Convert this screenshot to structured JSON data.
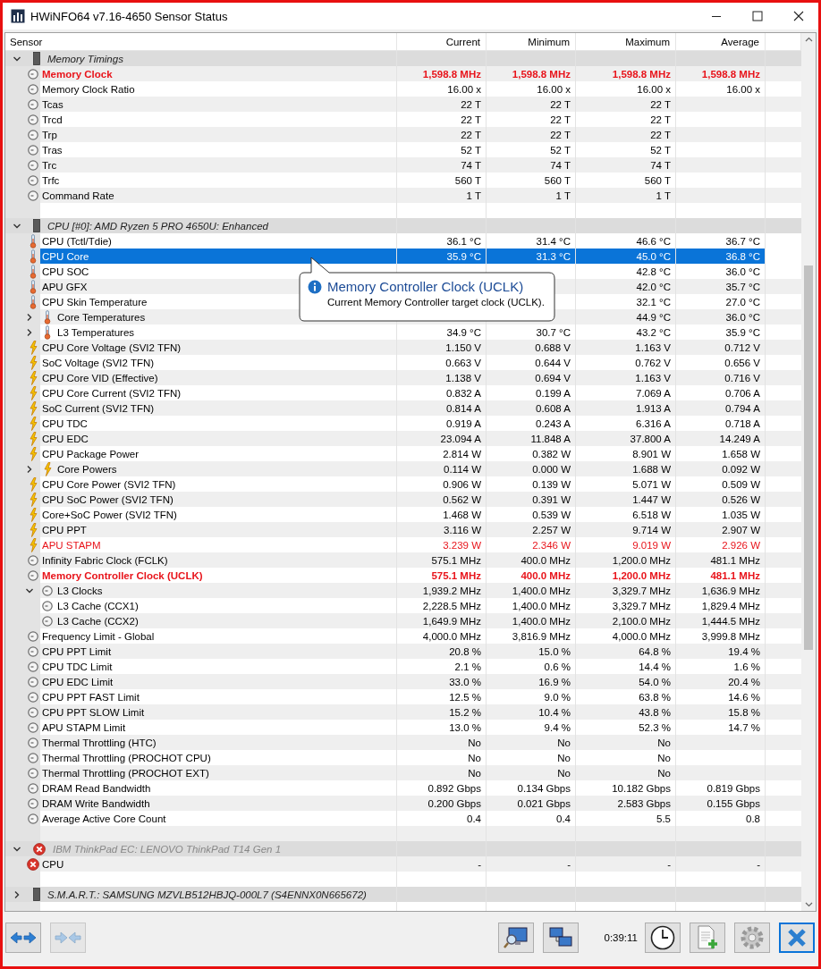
{
  "window": {
    "title": "HWiNFO64 v7.16-4650 Sensor Status"
  },
  "columns": [
    "Sensor",
    "Current",
    "Minimum",
    "Maximum",
    "Average"
  ],
  "groups": [
    {
      "name": "Memory Timings",
      "kind": "device",
      "expanded": true,
      "disabled": false,
      "selected": false,
      "items": [
        {
          "kind": "clock",
          "name": "Memory Clock",
          "color": "#e8141b",
          "emphasized": true,
          "selected": false,
          "current": "1,598.8 MHz",
          "minimum": "1,598.8 MHz",
          "maximum": "1,598.8 MHz",
          "average": "1,598.8 MHz"
        },
        {
          "kind": "clock",
          "name": "Memory Clock Ratio",
          "selected": false,
          "current": "16.00 x",
          "minimum": "16.00 x",
          "maximum": "16.00 x",
          "average": "16.00 x"
        },
        {
          "kind": "clock",
          "name": "Tcas",
          "selected": false,
          "current": "22 T",
          "minimum": "22 T",
          "maximum": "22 T"
        },
        {
          "kind": "clock",
          "name": "Trcd",
          "selected": false,
          "current": "22 T",
          "minimum": "22 T",
          "maximum": "22 T"
        },
        {
          "kind": "clock",
          "name": "Trp",
          "selected": false,
          "current": "22 T",
          "minimum": "22 T",
          "maximum": "22 T"
        },
        {
          "kind": "clock",
          "name": "Tras",
          "selected": false,
          "current": "52 T",
          "minimum": "52 T",
          "maximum": "52 T"
        },
        {
          "kind": "clock",
          "name": "Trc",
          "selected": false,
          "current": "74 T",
          "minimum": "74 T",
          "maximum": "74 T"
        },
        {
          "kind": "clock",
          "name": "Trfc",
          "selected": false,
          "current": "560 T",
          "minimum": "560 T",
          "maximum": "560 T"
        },
        {
          "kind": "clock",
          "name": "Command Rate",
          "selected": false,
          "current": "1 T",
          "minimum": "1 T",
          "maximum": "1 T"
        }
      ]
    },
    {
      "name": "CPU [#0]: AMD Ryzen 5 PRO 4650U: Enhanced",
      "kind": "device",
      "expanded": true,
      "disabled": false,
      "selected": false,
      "items": [
        {
          "kind": "temp",
          "name": "CPU (Tctl/Tdie)",
          "selected": false,
          "current": "36.1 °C",
          "minimum": "31.4 °C",
          "maximum": "46.6 °C",
          "average": "36.7 °C"
        },
        {
          "kind": "temp",
          "name": "CPU Core",
          "selected": true,
          "current": "35.9 °C",
          "minimum": "31.3 °C",
          "maximum": "45.0 °C",
          "average": "36.8 °C"
        },
        {
          "kind": "temp",
          "name": "CPU SOC",
          "selected": false,
          "maximum": "42.8 °C",
          "average": "36.0 °C"
        },
        {
          "kind": "temp",
          "name": "APU GFX",
          "selected": false,
          "maximum": "42.0 °C",
          "average": "35.7 °C"
        },
        {
          "kind": "temp",
          "name": "CPU Skin Temperature",
          "selected": false,
          "maximum": "32.1 °C",
          "average": "27.0 °C"
        },
        {
          "kind": "temp",
          "name": "Core Temperatures",
          "expanded": false,
          "selected": false,
          "maximum": "44.9 °C",
          "average": "36.0 °C"
        },
        {
          "kind": "temp",
          "name": "L3 Temperatures",
          "expanded": false,
          "selected": false,
          "current": "34.9 °C",
          "minimum": "30.7 °C",
          "maximum": "43.2 °C",
          "average": "35.9 °C"
        },
        {
          "kind": "power",
          "name": "CPU Core Voltage (SVI2 TFN)",
          "selected": false,
          "current": "1.150 V",
          "minimum": "0.688 V",
          "maximum": "1.163 V",
          "average": "0.712 V"
        },
        {
          "kind": "power",
          "name": "SoC Voltage (SVI2 TFN)",
          "selected": false,
          "current": "0.663 V",
          "minimum": "0.644 V",
          "maximum": "0.762 V",
          "average": "0.656 V"
        },
        {
          "kind": "power",
          "name": "CPU Core VID (Effective)",
          "selected": false,
          "current": "1.138 V",
          "minimum": "0.694 V",
          "maximum": "1.163 V",
          "average": "0.716 V"
        },
        {
          "kind": "power",
          "name": "CPU Core Current (SVI2 TFN)",
          "selected": false,
          "current": "0.832 A",
          "minimum": "0.199 A",
          "maximum": "7.069 A",
          "average": "0.706 A"
        },
        {
          "kind": "power",
          "name": "SoC Current (SVI2 TFN)",
          "selected": false,
          "current": "0.814 A",
          "minimum": "0.608 A",
          "maximum": "1.913 A",
          "average": "0.794 A"
        },
        {
          "kind": "power",
          "name": "CPU TDC",
          "selected": false,
          "current": "0.919 A",
          "minimum": "0.243 A",
          "maximum": "6.316 A",
          "average": "0.718 A"
        },
        {
          "kind": "power",
          "name": "CPU EDC",
          "selected": false,
          "current": "23.094 A",
          "minimum": "11.848 A",
          "maximum": "37.800 A",
          "average": "14.249 A"
        },
        {
          "kind": "power",
          "name": "CPU Package Power",
          "selected": false,
          "current": "2.814 W",
          "minimum": "0.382 W",
          "maximum": "8.901 W",
          "average": "1.658 W"
        },
        {
          "kind": "power",
          "name": "Core Powers",
          "expanded": false,
          "selected": false,
          "current": "0.114 W",
          "minimum": "0.000 W",
          "maximum": "1.688 W",
          "average": "0.092 W"
        },
        {
          "kind": "power",
          "name": "CPU Core Power (SVI2 TFN)",
          "selected": false,
          "current": "0.906 W",
          "minimum": "0.139 W",
          "maximum": "5.071 W",
          "average": "0.509 W"
        },
        {
          "kind": "power",
          "name": "CPU SoC Power (SVI2 TFN)",
          "selected": false,
          "current": "0.562 W",
          "minimum": "0.391 W",
          "maximum": "1.447 W",
          "average": "0.526 W"
        },
        {
          "kind": "power",
          "name": "Core+SoC Power (SVI2 TFN)",
          "selected": false,
          "current": "1.468 W",
          "minimum": "0.539 W",
          "maximum": "6.518 W",
          "average": "1.035 W"
        },
        {
          "kind": "power",
          "name": "CPU PPT",
          "selected": false,
          "current": "3.116 W",
          "minimum": "2.257 W",
          "maximum": "9.714 W",
          "average": "2.907 W"
        },
        {
          "kind": "power",
          "name": "APU STAPM",
          "color": "#e8141b",
          "emphasized": false,
          "selected": false,
          "current": "3.239 W",
          "minimum": "2.346 W",
          "maximum": "9.019 W",
          "average": "2.926 W"
        },
        {
          "kind": "clock",
          "name": "Infinity Fabric Clock (FCLK)",
          "selected": false,
          "current": "575.1 MHz",
          "minimum": "400.0 MHz",
          "maximum": "1,200.0 MHz",
          "average": "481.1 MHz"
        },
        {
          "kind": "clock",
          "name": "Memory Controller Clock (UCLK)",
          "color": "#e8141b",
          "emphasized": true,
          "selected": false,
          "current": "575.1 MHz",
          "minimum": "400.0 MHz",
          "maximum": "1,200.0 MHz",
          "average": "481.1 MHz"
        },
        {
          "kind": "clock",
          "name": "L3 Clocks",
          "expanded": true,
          "selected": false,
          "current": "1,939.2 MHz",
          "minimum": "1,400.0 MHz",
          "maximum": "3,329.7 MHz",
          "average": "1,636.9 MHz",
          "children": [
            {
              "kind": "clock",
              "name": "L3 Cache (CCX1)",
              "selected": false,
              "current": "2,228.5 MHz",
              "minimum": "1,400.0 MHz",
              "maximum": "3,329.7 MHz",
              "average": "1,829.4 MHz"
            },
            {
              "kind": "clock",
              "name": "L3 Cache (CCX2)",
              "selected": false,
              "current": "1,649.9 MHz",
              "minimum": "1,400.0 MHz",
              "maximum": "2,100.0 MHz",
              "average": "1,444.5 MHz"
            }
          ]
        },
        {
          "kind": "clock",
          "name": "Frequency Limit - Global",
          "selected": false,
          "current": "4,000.0 MHz",
          "minimum": "3,816.9 MHz",
          "maximum": "4,000.0 MHz",
          "average": "3,999.8 MHz"
        },
        {
          "kind": "clock",
          "name": "CPU PPT Limit",
          "selected": false,
          "current": "20.8 %",
          "minimum": "15.0 %",
          "maximum": "64.8 %",
          "average": "19.4 %"
        },
        {
          "kind": "clock",
          "name": "CPU TDC Limit",
          "selected": false,
          "current": "2.1 %",
          "minimum": "0.6 %",
          "maximum": "14.4 %",
          "average": "1.6 %"
        },
        {
          "kind": "clock",
          "name": "CPU EDC Limit",
          "selected": false,
          "current": "33.0 %",
          "minimum": "16.9 %",
          "maximum": "54.0 %",
          "average": "20.4 %"
        },
        {
          "kind": "clock",
          "name": "CPU PPT FAST Limit",
          "selected": false,
          "current": "12.5 %",
          "minimum": "9.0 %",
          "maximum": "63.8 %",
          "average": "14.6 %"
        },
        {
          "kind": "clock",
          "name": "CPU PPT SLOW Limit",
          "selected": false,
          "current": "15.2 %",
          "minimum": "10.4 %",
          "maximum": "43.8 %",
          "average": "15.8 %"
        },
        {
          "kind": "clock",
          "name": "APU STAPM Limit",
          "selected": false,
          "current": "13.0 %",
          "minimum": "9.4 %",
          "maximum": "52.3 %",
          "average": "14.7 %"
        },
        {
          "kind": "clock",
          "name": "Thermal Throttling (HTC)",
          "selected": false,
          "current": "No",
          "minimum": "No",
          "maximum": "No"
        },
        {
          "kind": "clock",
          "name": "Thermal Throttling (PROCHOT CPU)",
          "selected": false,
          "current": "No",
          "minimum": "No",
          "maximum": "No"
        },
        {
          "kind": "clock",
          "name": "Thermal Throttling (PROCHOT EXT)",
          "selected": false,
          "current": "No",
          "minimum": "No",
          "maximum": "No"
        },
        {
          "kind": "clock",
          "name": "DRAM Read Bandwidth",
          "selected": false,
          "current": "0.892 Gbps",
          "minimum": "0.134 Gbps",
          "maximum": "10.182 Gbps",
          "average": "0.819 Gbps"
        },
        {
          "kind": "clock",
          "name": "DRAM Write Bandwidth",
          "selected": false,
          "current": "0.200 Gbps",
          "minimum": "0.021 Gbps",
          "maximum": "2.583 Gbps",
          "average": "0.155 Gbps"
        },
        {
          "kind": "clock",
          "name": "Average Active Core Count",
          "selected": false,
          "current": "0.4",
          "minimum": "0.4",
          "maximum": "5.5",
          "average": "0.8"
        }
      ]
    },
    {
      "name": "IBM ThinkPad EC: LENOVO ThinkPad T14 Gen 1",
      "kind": "error",
      "expanded": true,
      "disabled": true,
      "selected": false,
      "items": [
        {
          "kind": "error",
          "name": "CPU",
          "selected": false,
          "current": "-",
          "minimum": "-",
          "maximum": "-",
          "average": "-"
        }
      ]
    },
    {
      "name": "S.M.A.R.T.: SAMSUNG MZVLB512HBJQ-000L7 (S4ENNX0N665672)",
      "kind": "device",
      "expanded": false,
      "disabled": false,
      "selected": false
    }
  ],
  "tooltip": {
    "title": "Memory Controller Clock (UCLK)",
    "text": "Current Memory Controller target clock (UCLK)."
  },
  "toolbar": {
    "elapsed": "0:39:11"
  }
}
